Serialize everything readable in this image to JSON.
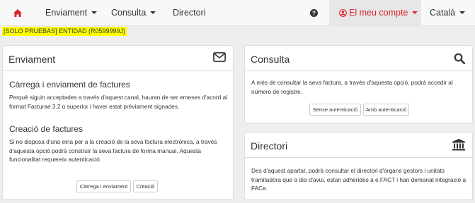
{
  "nav": {
    "home_icon": "home-icon",
    "enviament": "Enviament",
    "consulta": "Consulta",
    "directori": "Directori",
    "help_icon": "question-circle-icon",
    "account_icon": "user-circle-icon",
    "account": "El meu compte",
    "language": "Català",
    "accent_color": "#d9252c"
  },
  "entity_banner": "[SOLO PRUEBAS] ENTIDAD (R0599999J)",
  "panels": {
    "enviament": {
      "title": "Enviament",
      "icon": "envelope-icon",
      "section1_title": "Càrrega i enviament de factures",
      "section1_text": "Perquè siguin acceptades a través d'aquest canal, hauran de ser emeses d'acord al format Facturae 3.2 o superior i haver estat prèviament signades.",
      "section2_title": "Creació de factures",
      "section2_text": "Si no disposa d'una eina per a la creació de la seva factura electrònica, a través d'aquesta opció podrà construir la seva factura de forma manual. Aquesta funcionalitat requereix autenticació.",
      "btn_upload": "Càrrega i enviament",
      "btn_create": "Creació"
    },
    "consulta": {
      "title": "Consulta",
      "icon": "search-icon",
      "text": "A més de consultar la seva factura, a través d'aquesta opció, podrà accedir al número de registre.",
      "btn_no_auth": "Sense autenticació",
      "btn_auth": "Amb autenticació"
    },
    "directori": {
      "title": "Directori",
      "icon": "institution-icon",
      "text": "Des d'aquest apartat, podrà consultar el directori d'òrgans gestors i unitats tramitadora que a dia d'avui, estan adherides a e.FACT i han demanat integració a FACe."
    }
  }
}
